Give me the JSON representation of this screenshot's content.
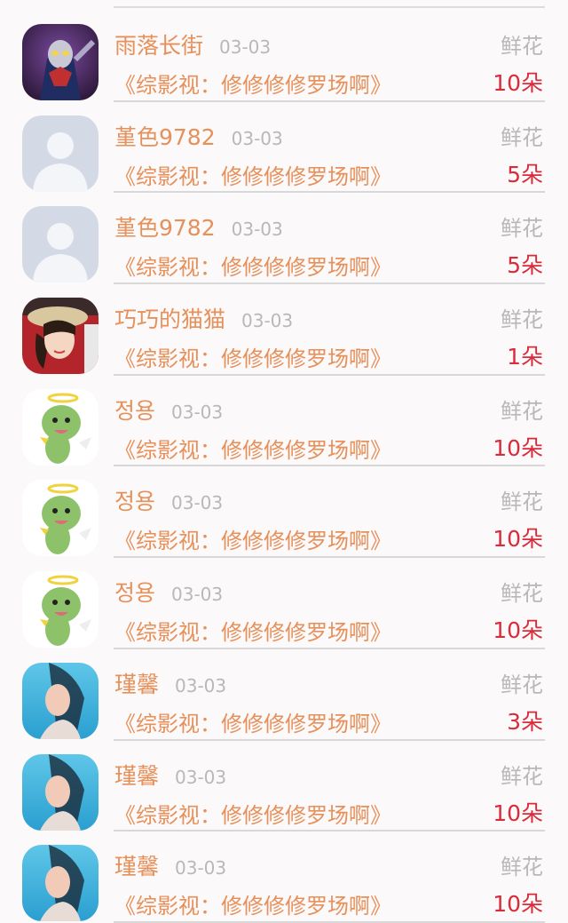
{
  "records": [
    {
      "name": "雨落长街",
      "date": "03-03",
      "gift": "鲜花",
      "book": "《综影视：修修修修罗场啊》",
      "count": "10朵",
      "avatar": "hero-avatar-icon"
    },
    {
      "name": "堇色9782",
      "date": "03-03",
      "gift": "鲜花",
      "book": "《综影视：修修修修罗场啊》",
      "count": "5朵",
      "avatar": "default-user-avatar-icon"
    },
    {
      "name": "堇色9782",
      "date": "03-03",
      "gift": "鲜花",
      "book": "《综影视：修修修修罗场啊》",
      "count": "5朵",
      "avatar": "default-user-avatar-icon"
    },
    {
      "name": "巧巧的猫猫",
      "date": "03-03",
      "gift": "鲜花",
      "book": "《综影视：修修修修罗场啊》",
      "count": "1朵",
      "avatar": "girl-hat-avatar-icon"
    },
    {
      "name": "정용",
      "date": "03-03",
      "gift": "鲜花",
      "book": "《综影视：修修修修罗场啊》",
      "count": "10朵",
      "avatar": "angel-dino-avatar-icon"
    },
    {
      "name": "정용",
      "date": "03-03",
      "gift": "鲜花",
      "book": "《综影视：修修修修罗场啊》",
      "count": "10朵",
      "avatar": "angel-dino-avatar-icon"
    },
    {
      "name": "정용",
      "date": "03-03",
      "gift": "鲜花",
      "book": "《综影视：修修修修罗场啊》",
      "count": "10朵",
      "avatar": "angel-dino-avatar-icon"
    },
    {
      "name": "瑾馨",
      "date": "03-03",
      "gift": "鲜花",
      "book": "《综影视：修修修修罗场啊》",
      "count": "3朵",
      "avatar": "underwater-girl-avatar-icon"
    },
    {
      "name": "瑾馨",
      "date": "03-03",
      "gift": "鲜花",
      "book": "《综影视：修修修修罗场啊》",
      "count": "10朵",
      "avatar": "underwater-girl-avatar-icon"
    },
    {
      "name": "瑾馨",
      "date": "03-03",
      "gift": "鲜花",
      "book": "《综影视：修修修修罗场啊》",
      "count": "10朵",
      "avatar": "underwater-girl-avatar-icon"
    }
  ],
  "colors": {
    "name": "#e6905a",
    "date": "#b8b8b8",
    "count": "#d92b3a",
    "background": "#fcf9fa"
  }
}
